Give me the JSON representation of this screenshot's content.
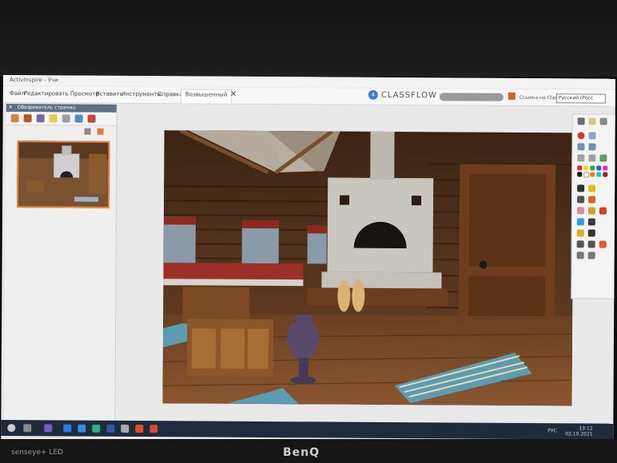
{
  "window": {
    "title": "ActivInspire - Учи"
  },
  "menu": {
    "items": [
      "Файл",
      "Редактировать",
      "Просмотр",
      "Вставить",
      "Инструменты",
      "Справка",
      "Возвышенный"
    ],
    "active_index": 6
  },
  "brand_bar": {
    "classflow": "CLASSFLOW",
    "share_label": "Ссылка на ClassFlow",
    "language": "Русский (Росс"
  },
  "left_panel": {
    "title": "Обозреватель страниц"
  },
  "taskbar": {
    "time": "13:12",
    "date": "02.10.2021",
    "lang": "РУС"
  },
  "monitor": {
    "brand": "BenQ",
    "sticker": "senseye+ LED"
  },
  "colors": {
    "accent": "#e8873c",
    "panel_header": "#5f6f86",
    "taskbar": "#1f2a3a"
  }
}
